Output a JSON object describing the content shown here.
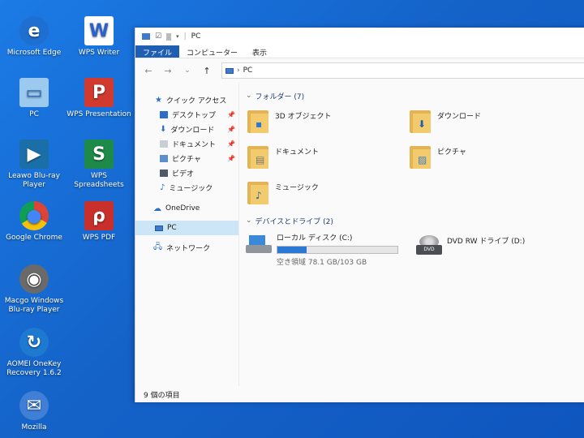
{
  "desktop": {
    "icons": [
      {
        "label": "Microsoft Edge",
        "icon": "edge-icon",
        "color": "#1f6fd0",
        "glyph": "e"
      },
      {
        "label": "WPS Writer",
        "icon": "wps-writer-icon",
        "color": "#2a62c9",
        "glyph": "W"
      },
      {
        "label": "PC",
        "icon": "pc-icon",
        "color": "#3a8fdc",
        "glyph": "▭"
      },
      {
        "label": "WPS Presentation",
        "icon": "wps-presentation-icon",
        "color": "#d13a2f",
        "glyph": "P"
      },
      {
        "label": "Leawo Blu-ray Player",
        "icon": "leawo-icon",
        "color": "#1a6fa8",
        "glyph": "▶"
      },
      {
        "label": "WPS Spreadsheets",
        "icon": "wps-spreadsheets-icon",
        "color": "#1d8a4a",
        "glyph": "S"
      },
      {
        "label": "Google Chrome",
        "icon": "chrome-icon",
        "color": "#e0e0e0",
        "glyph": "●"
      },
      {
        "label": "WPS PDF",
        "icon": "wps-pdf-icon",
        "color": "#c9302c",
        "glyph": "ρ"
      },
      {
        "label": "Macgo Windows Blu-ray Player",
        "icon": "macgo-icon",
        "color": "#6a6a6a",
        "glyph": "◉"
      },
      {
        "label": "AOMEI OneKey Recovery 1.6.2",
        "icon": "aomei-icon",
        "color": "#1e7ad0",
        "glyph": "↻"
      },
      {
        "label": "Mozilla",
        "icon": "firefox-icon",
        "color": "#3f7fd6",
        "glyph": "✉"
      }
    ]
  },
  "window": {
    "title": "PC",
    "tabs": [
      {
        "label": "ファイル",
        "active": true
      },
      {
        "label": "コンピューター"
      },
      {
        "label": "表示"
      }
    ],
    "address": "PC",
    "nav_back": "←",
    "nav_forward": "→",
    "nav_dropdown": "⌄",
    "nav_up": "↑",
    "navpane": {
      "quick_access": "クイック アクセス",
      "quick_items": [
        "デスクトップ",
        "ダウンロード",
        "ドキュメント",
        "ピクチャ",
        "ビデオ",
        "ミュージック"
      ],
      "onedrive": "OneDrive",
      "pc": "PC",
      "network": "ネットワーク"
    },
    "folders_header": "フォルダー (7)",
    "folders": [
      {
        "label": "3D オブジェクト",
        "overlay": "▪"
      },
      {
        "label": "ダウンロード",
        "overlay": "⬇"
      },
      {
        "label": "ドキュメント",
        "overlay": "▤"
      },
      {
        "label": "ピクチャ",
        "overlay": "▨"
      },
      {
        "label": "ミュージック",
        "overlay": "♪"
      }
    ],
    "drives_header": "デバイスとドライブ (2)",
    "drives": {
      "local": {
        "label": "ローカル ディスク (C:)",
        "usage": "空き領域 78.1 GB/103 GB",
        "used_fraction": 0.24
      },
      "dvd": {
        "label": "DVD RW ドライブ (D:)",
        "badge": "DVD"
      }
    },
    "status": "9 個の項目"
  },
  "colors": {
    "accent": "#1e5fb4",
    "selection": "#cde6f7",
    "folder": "#f3cb6c",
    "bar_fill": "#2a7ad5"
  }
}
